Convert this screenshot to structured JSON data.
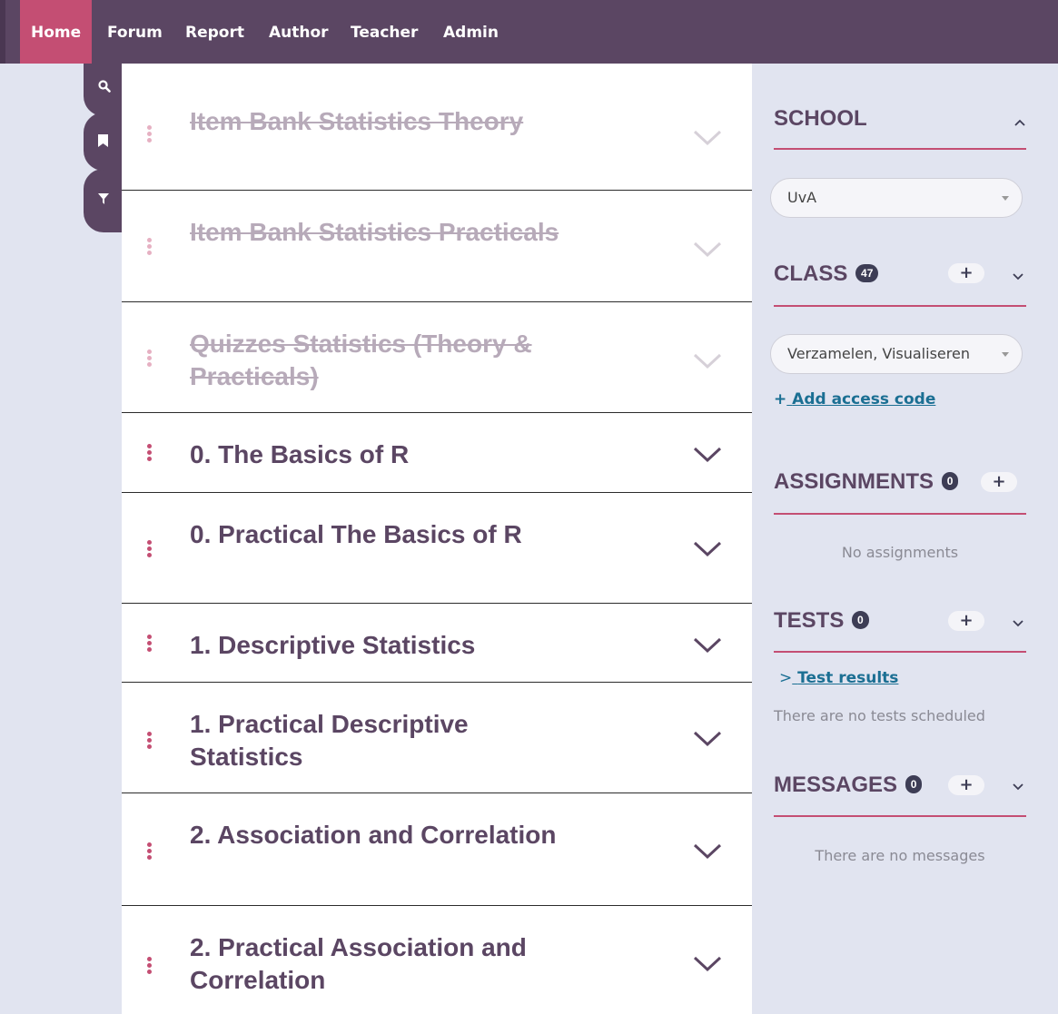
{
  "nav": {
    "items": [
      {
        "label": "Home",
        "active": true
      },
      {
        "label": "Forum"
      },
      {
        "label": "Report"
      },
      {
        "label": "Author"
      },
      {
        "label": "Teacher"
      },
      {
        "label": "Admin"
      }
    ]
  },
  "side_tabs": {
    "icons": [
      "search-icon",
      "bookmark-icon",
      "filter-icon"
    ]
  },
  "chapters": [
    {
      "title": "Item Bank Statistics Theory",
      "disabled": true
    },
    {
      "title": "Item Bank Statistics Practicals",
      "disabled": true
    },
    {
      "title": "Quizzes Statistics (Theory & Practicals)",
      "disabled": true
    },
    {
      "title": "0. The Basics of R",
      "disabled": false
    },
    {
      "title": "0. Practical The Basics of R",
      "disabled": false
    },
    {
      "title": "1. Descriptive Statistics",
      "disabled": false
    },
    {
      "title": "1. Practical Descriptive Statistics",
      "disabled": false
    },
    {
      "title": "2. Association and Correlation",
      "disabled": false
    },
    {
      "title": "2. Practical Association and Correlation",
      "disabled": false
    }
  ],
  "sidebar": {
    "school": {
      "heading": "SCHOOL",
      "selected": "UvA"
    },
    "class": {
      "heading": "CLASS",
      "count": "47",
      "selected": "Verzamelen, Visualiseren",
      "add_access_code": "Add access code"
    },
    "assignments": {
      "heading": "ASSIGNMENTS",
      "count": "0",
      "empty": "No assignments"
    },
    "tests": {
      "heading": "TESTS",
      "count": "0",
      "results_link": "Test results",
      "empty": "There are no tests scheduled"
    },
    "messages": {
      "heading": "MESSAGES",
      "count": "0",
      "empty": "There are no messages"
    }
  },
  "colors": {
    "nav": "#5b4663",
    "accent": "#c44e73",
    "link": "#1b6f93"
  }
}
